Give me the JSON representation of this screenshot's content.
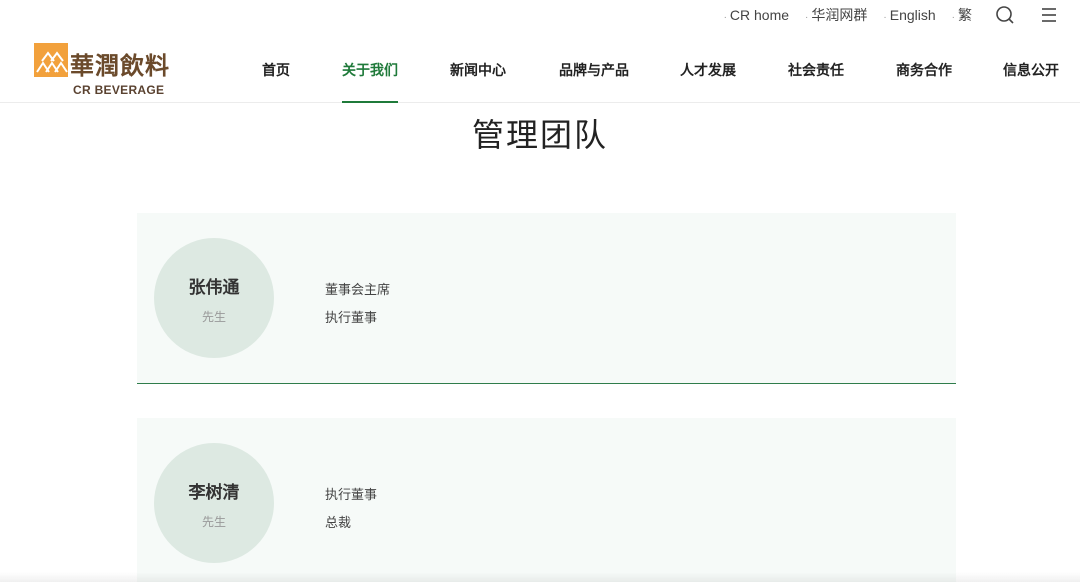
{
  "utility": {
    "links": [
      "CR home",
      "华润网群",
      "English",
      "繁"
    ],
    "icons": [
      "search-icon",
      "menu-icon"
    ]
  },
  "logo": {
    "cn": "華潤飲料",
    "en": "CR BEVERAGE"
  },
  "nav": {
    "items": [
      "首页",
      "关于我们",
      "新闻中心",
      "品牌与产品",
      "人才发展",
      "社会责任",
      "商务合作",
      "信息公开"
    ],
    "active": "关于我们"
  },
  "page": {
    "title": "管理团队"
  },
  "team": [
    {
      "name": "张伟通",
      "honorific": "先生",
      "roles": [
        "董事会主席",
        "执行董事"
      ]
    },
    {
      "name": "李树清",
      "honorific": "先生",
      "roles": [
        "执行董事",
        "总裁"
      ]
    }
  ],
  "colors": {
    "accent": "#1f7a3a",
    "logo_orange": "#f2a13c",
    "card_bg": "#f6faf8",
    "avatar_bg": "#dde9e2"
  }
}
